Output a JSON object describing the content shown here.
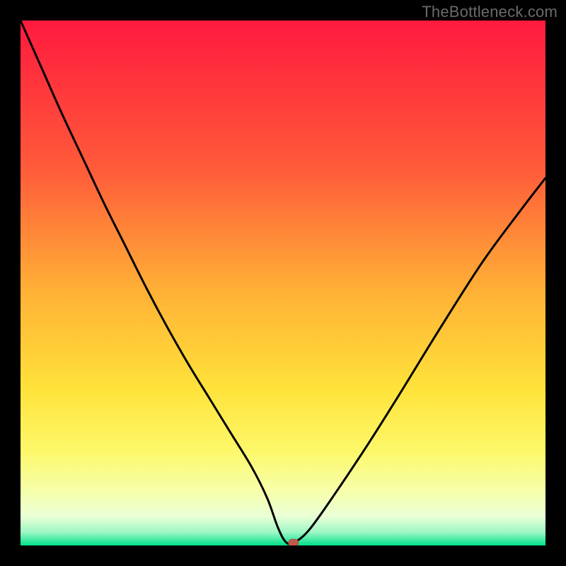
{
  "watermark": "TheBottleneck.com",
  "colors": {
    "frame": "#000000",
    "curve": "#000000",
    "marker_fill": "#c05a4d",
    "marker_stroke": "#b24a3e",
    "gradient_stops": [
      {
        "offset": 0.0,
        "color": "#ff1a3e"
      },
      {
        "offset": 0.28,
        "color": "#ff5a3a"
      },
      {
        "offset": 0.52,
        "color": "#ffb236"
      },
      {
        "offset": 0.7,
        "color": "#ffe23a"
      },
      {
        "offset": 0.82,
        "color": "#fdf86a"
      },
      {
        "offset": 0.9,
        "color": "#f6ffae"
      },
      {
        "offset": 0.945,
        "color": "#e9ffd6"
      },
      {
        "offset": 0.975,
        "color": "#9cf7c5"
      },
      {
        "offset": 1.0,
        "color": "#00e08a"
      }
    ]
  },
  "chart_data": {
    "type": "line",
    "title": "",
    "xlabel": "",
    "ylabel": "",
    "xlim": [
      0,
      100
    ],
    "ylim": [
      0,
      100
    ],
    "x": [
      0,
      4,
      8,
      12,
      16,
      20,
      24,
      28,
      32,
      36,
      40,
      44,
      47,
      49,
      50.5,
      52,
      55,
      60,
      66,
      72,
      80,
      88,
      95,
      100
    ],
    "values": [
      100,
      91,
      82,
      73.5,
      65,
      57,
      49,
      41.5,
      34.5,
      28,
      21.5,
      15,
      9,
      3.5,
      0.7,
      0.5,
      3,
      10,
      19,
      28.5,
      41.5,
      54,
      63.5,
      70
    ],
    "marker": {
      "x": 52,
      "y": 0.5
    },
    "notes": "Values read from the curve as percentages of the plot area; y=0 is the bottom edge, y=100 is the top edge. There is a small flat notch at the trough between roughly x=49 and x=52."
  }
}
